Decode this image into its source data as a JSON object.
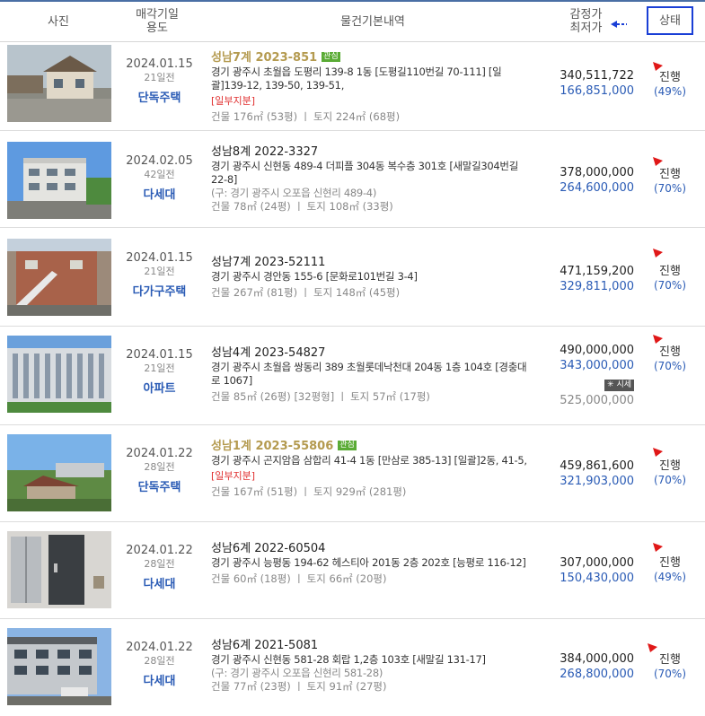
{
  "header": {
    "photo": "사진",
    "sale_date": "매각기일",
    "usage": "용도",
    "info": "물건기본내역",
    "appraisal": "감정가",
    "minimum": "최저가",
    "status": "상태"
  },
  "colors": {
    "accent": "#2a5bb5",
    "alert": "#e03030",
    "highlight_case": "#b49a4f",
    "badge_green": "#5aab35"
  },
  "rows": [
    {
      "date": "2024.01.15",
      "days": "21일전",
      "usage": "단독주택",
      "case": "성남7계 2023-851",
      "badge": "관심",
      "address": "경기 광주시 초월읍 도평리 139-8 1동 [도평길110번길 70-111] [일괄]139-12, 139-50, 139-51,",
      "partial": "[일부지분]",
      "area": "건물 176㎡ (53평)  ㅣ  토지 224㎡ (68평)",
      "appraisal": "340,511,722",
      "minimum": "166,851,000",
      "status": "진행",
      "pct": "(49%)"
    },
    {
      "date": "2024.02.05",
      "days": "42일전",
      "usage": "다세대",
      "case": "성남8계 2022-3327",
      "address": "경기 광주시 신현동 489-4 더피플 304동 복수층 301호 [새말길304번길 22-8]",
      "old_address": "(구: 경기 광주시 오포읍 신현리 489-4)",
      "area": "건물 78㎡ (24평)  ㅣ  토지 108㎡ (33평)",
      "appraisal": "378,000,000",
      "minimum": "264,600,000",
      "status": "진행",
      "pct": "(70%)"
    },
    {
      "date": "2024.01.15",
      "days": "21일전",
      "usage": "다가구주택",
      "case": "성남7계 2023-52111",
      "address": "경기 광주시 경안동 155-6 [문화로101번길 3-4]",
      "area": "건물 267㎡ (81평)  ㅣ  토지 148㎡ (45평)",
      "appraisal": "471,159,200",
      "minimum": "329,811,000",
      "status": "진행",
      "pct": "(70%)"
    },
    {
      "date": "2024.01.15",
      "days": "21일전",
      "usage": "아파트",
      "case": "성남4계 2023-54827",
      "address": "경기 광주시 초월읍 쌍동리 389 초월롯데낙천대 204동 1층 104호 [경충대로 1067]",
      "area": "건물 85㎡ (26평) [32평형]  ㅣ  토지 57㎡ (17평)",
      "appraisal": "490,000,000",
      "minimum": "343,000,000",
      "market_label": "시세",
      "market": "525,000,000",
      "status": "진행",
      "pct": "(70%)"
    },
    {
      "date": "2024.01.22",
      "days": "28일전",
      "usage": "단독주택",
      "case": "성남1계 2023-55806",
      "badge": "관심",
      "address": "경기 광주시 곤지암읍 삼합리 41-4 1동 [만삼로 385-13] [일괄]2동, 41-5,",
      "partial": "[일부지분]",
      "area": "건물 167㎡ (51평)  ㅣ  토지 929㎡ (281평)",
      "appraisal": "459,861,600",
      "minimum": "321,903,000",
      "status": "진행",
      "pct": "(70%)"
    },
    {
      "date": "2024.01.22",
      "days": "28일전",
      "usage": "다세대",
      "case": "성남6계 2022-60504",
      "address": "경기 광주시 능평동 194-62 헤스티아 201동 2층 202호 [능평로 116-12]",
      "area": "건물 60㎡ (18평)  ㅣ  토지 66㎡ (20평)",
      "appraisal": "307,000,000",
      "minimum": "150,430,000",
      "status": "진행",
      "pct": "(49%)"
    },
    {
      "date": "2024.01.22",
      "days": "28일전",
      "usage": "다세대",
      "case": "성남6계 2021-5081",
      "address": "경기 광주시 신현동 581-28 회랍 1,2층 103호 [새말길 131-17]",
      "old_address": "(구: 경기 광주시 오포읍 신현리 581-28)",
      "area": "건물 77㎡ (23평)  ㅣ  토지 91㎡ (27평)",
      "appraisal": "384,000,000",
      "minimum": "268,800,000",
      "status": "진행",
      "pct": "(70%)"
    }
  ]
}
